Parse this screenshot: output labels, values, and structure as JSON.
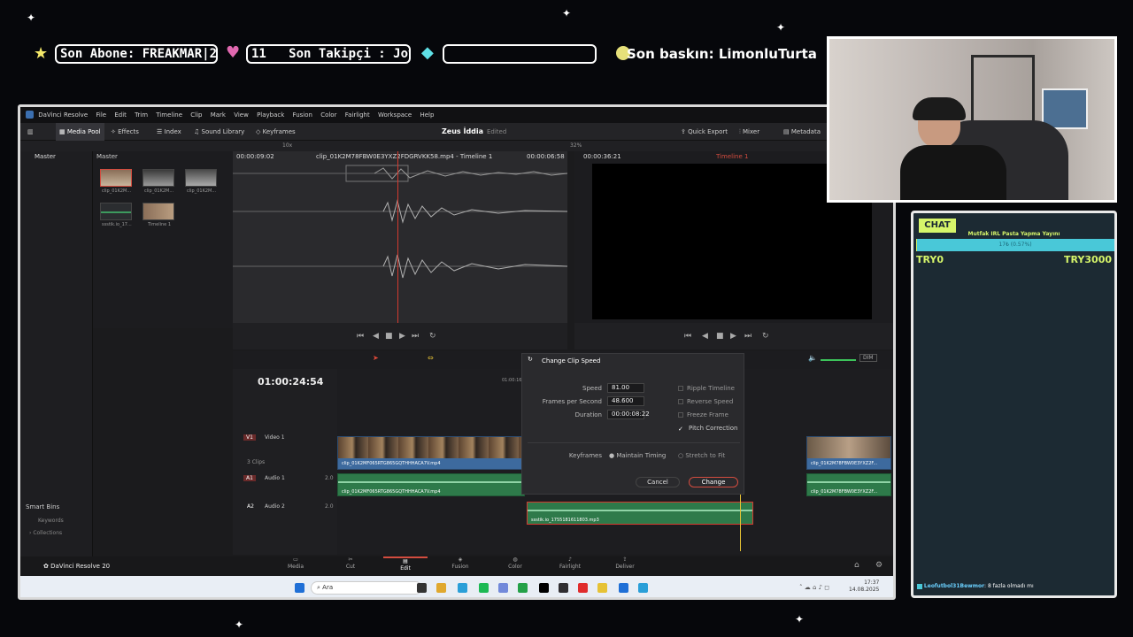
{
  "ticker": {
    "last_sub": "Son Abone: FREAKMAR|2",
    "follow_count": "11",
    "last_follow": "Son Takipçi : JoyCook67",
    "last_raid": "Son baskın: LimonluTurta"
  },
  "resolve": {
    "menu": [
      "DaVinci Resolve",
      "File",
      "Edit",
      "Trim",
      "Timeline",
      "Clip",
      "Mark",
      "View",
      "Playback",
      "Fusion",
      "Color",
      "Fairlight",
      "Workspace",
      "Help"
    ],
    "toolbar": {
      "media_pool": "Media Pool",
      "effects": "Effects",
      "index": "Index",
      "sound_library": "Sound Library",
      "keyframes": "Keyframes",
      "project_title": "Zeus İddia",
      "status": "Edited",
      "quick_export": "Quick Export",
      "mixer": "Mixer",
      "metadata": "Metadata"
    },
    "subbar": {
      "zoom": "10x",
      "viewer_zoom": "32%",
      "src_tc": "00:00:09:02",
      "clip_name": "clip_01K2M78FBW0E3YXZ2FDGRVKK58.mp4 - Timeline 1",
      "src_dur": "00:00:06:58",
      "prog_tc": "00:00:36:21",
      "timeline_name": "Timeline 1"
    },
    "sidebar": {
      "master": "Master",
      "smart_bins": "Smart Bins",
      "keywords": "Keywords",
      "collections": "Collections"
    },
    "pool": {
      "header": "Master",
      "items": [
        "clip_01K2M...",
        "clip_01K2M...",
        "clip_01K2M...",
        "ssstik.io_17...",
        "Timeline 1"
      ]
    },
    "timeline": {
      "timecode": "01:00:24:54",
      "ruler_tc": "01:00:16:00",
      "v1_code": "V1",
      "v1_name": "Video 1",
      "clips_count": "3 Clips",
      "a1_code": "A1",
      "a1_name": "Audio 1",
      "a2_code": "A2",
      "a2_name": "Audio 2",
      "a1_level": "2.0",
      "a2_level": "2.0",
      "v_clip_1": "clip_01K2MF065RTG865GQTHHHACA7V.mp4",
      "a_clip_1": "clip_01K2MF065RTG865GQTHHHACA7V.mp4",
      "a_clip_2": "ssstik.io_1755181611803.mp3",
      "v_clip_3": "clip_01K2M78FBW0E3YXZ2F...",
      "a_clip_3": "clip_01K2M78FBW0E3YXZ2F..."
    },
    "dialog": {
      "title": "Change Clip Speed",
      "speed_label": "Speed",
      "speed_value": "81.00",
      "fps_label": "Frames per Second",
      "fps_value": "48.600",
      "duration_label": "Duration",
      "duration_value": "00:00:08:22",
      "ripple": "Ripple Timeline",
      "reverse": "Reverse Speed",
      "freeze": "Freeze Frame",
      "pitch": "Pitch Correction",
      "keyframes_label": "Keyframes",
      "maintain": "Maintain Timing",
      "stretch": "Stretch to Fit",
      "cancel": "Cancel",
      "change": "Change"
    },
    "audio": {
      "dim": "DIM"
    },
    "pages": [
      "Media",
      "Cut",
      "Edit",
      "Fusion",
      "Color",
      "Fairlight",
      "Deliver"
    ],
    "brand": "DaVinci Resolve 20",
    "taskbar": {
      "search": "Ara",
      "time": "17:37",
      "date": "14.08.2025"
    }
  },
  "chat": {
    "title": "CHAT",
    "goal_title": "Mutfak IRL Pasta Yapma Yayını",
    "goal_progress_label": "17₺ (0.57%)",
    "goal_progress": 0.0057,
    "goal_min": "TRY0",
    "goal_max": "TRY3000",
    "message_user": "Leofutbol31Bewmor",
    "message_text": ": 8 fazla olmadı mı"
  }
}
